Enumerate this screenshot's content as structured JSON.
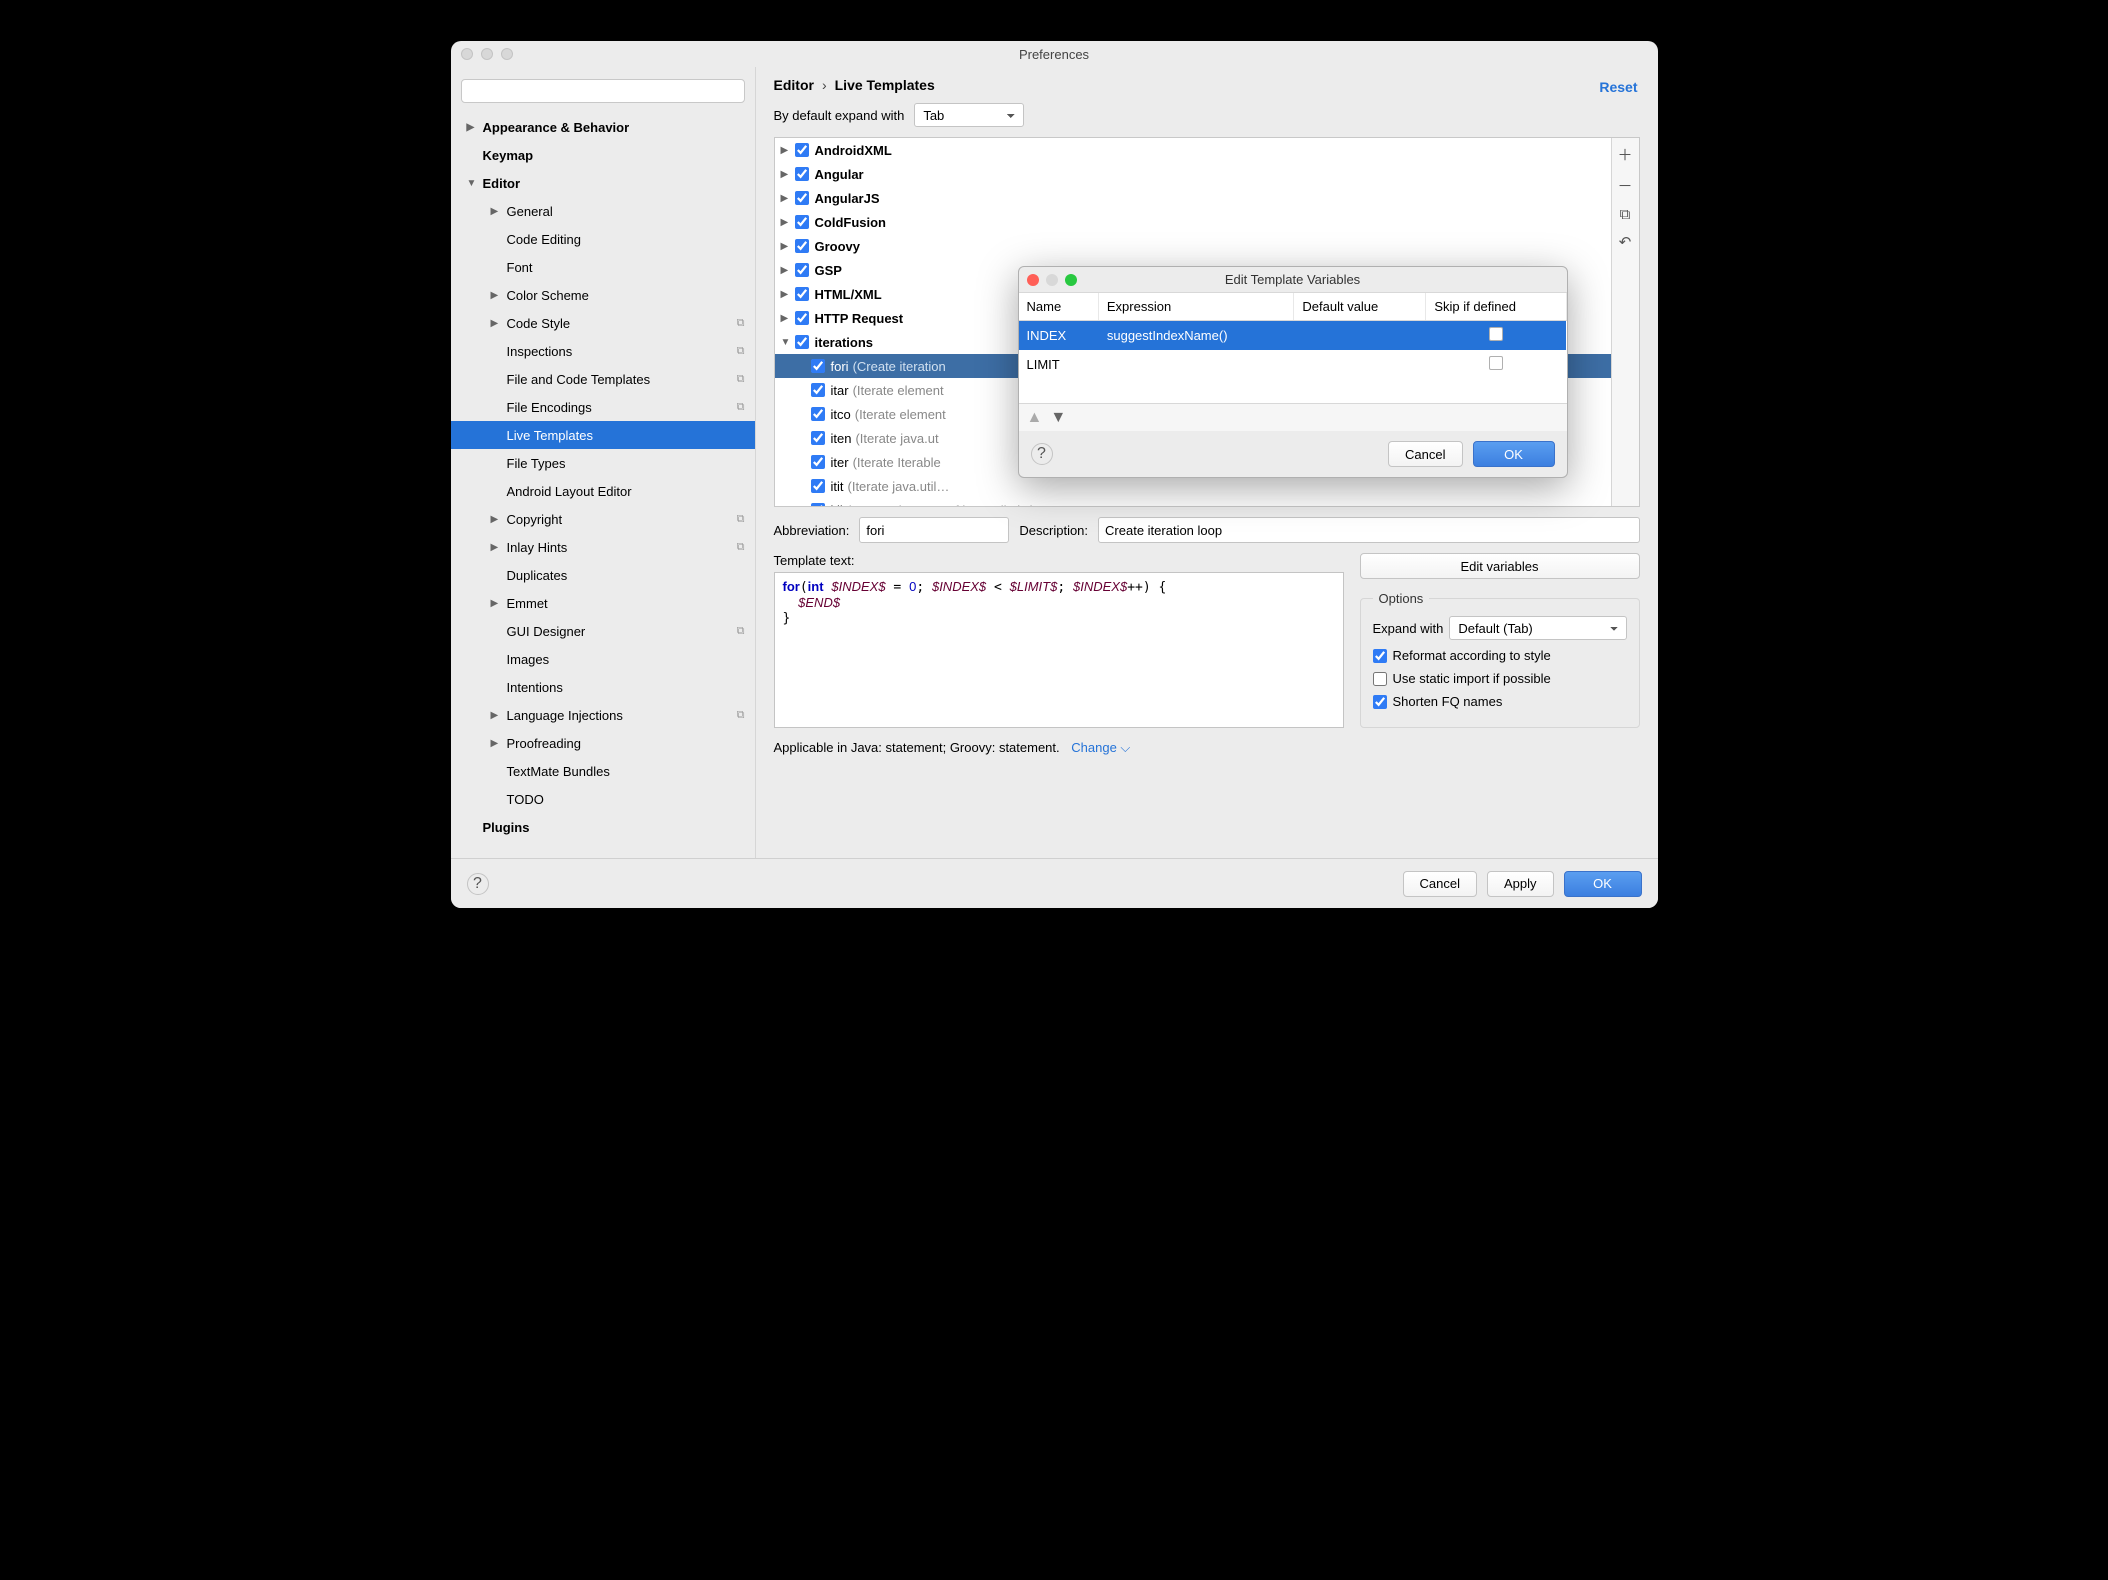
{
  "window": {
    "title": "Preferences"
  },
  "breadcrumb": {
    "section": "Editor",
    "page": "Live Templates",
    "reset": "Reset"
  },
  "sidebar": {
    "search_placeholder": "",
    "items": [
      {
        "label": "Appearance & Behavior",
        "arrow": "▶",
        "bold": true
      },
      {
        "label": "Keymap",
        "bold": true
      },
      {
        "label": "Editor",
        "arrow": "▼",
        "bold": true
      },
      {
        "label": "General",
        "arrow": "▶",
        "indent": 1
      },
      {
        "label": "Code Editing",
        "indent": 1
      },
      {
        "label": "Font",
        "indent": 1
      },
      {
        "label": "Color Scheme",
        "arrow": "▶",
        "indent": 1
      },
      {
        "label": "Code Style",
        "arrow": "▶",
        "indent": 1,
        "copy": true
      },
      {
        "label": "Inspections",
        "indent": 1,
        "copy": true
      },
      {
        "label": "File and Code Templates",
        "indent": 1,
        "copy": true
      },
      {
        "label": "File Encodings",
        "indent": 1,
        "copy": true
      },
      {
        "label": "Live Templates",
        "indent": 1,
        "selected": true
      },
      {
        "label": "File Types",
        "indent": 1
      },
      {
        "label": "Android Layout Editor",
        "indent": 1
      },
      {
        "label": "Copyright",
        "arrow": "▶",
        "indent": 1,
        "copy": true
      },
      {
        "label": "Inlay Hints",
        "arrow": "▶",
        "indent": 1,
        "copy": true
      },
      {
        "label": "Duplicates",
        "indent": 1
      },
      {
        "label": "Emmet",
        "arrow": "▶",
        "indent": 1
      },
      {
        "label": "GUI Designer",
        "indent": 1,
        "copy": true
      },
      {
        "label": "Images",
        "indent": 1
      },
      {
        "label": "Intentions",
        "indent": 1
      },
      {
        "label": "Language Injections",
        "arrow": "▶",
        "indent": 1,
        "copy": true
      },
      {
        "label": "Proofreading",
        "arrow": "▶",
        "indent": 1
      },
      {
        "label": "TextMate Bundles",
        "indent": 1
      },
      {
        "label": "TODO",
        "indent": 1
      },
      {
        "label": "Plugins",
        "bold": true
      }
    ]
  },
  "expand": {
    "label": "By default expand with",
    "value": "Tab"
  },
  "templates": [
    {
      "name": "AndroidXML",
      "checked": true,
      "arrow": "▶"
    },
    {
      "name": "Angular",
      "checked": true,
      "arrow": "▶"
    },
    {
      "name": "AngularJS",
      "checked": true,
      "arrow": "▶"
    },
    {
      "name": "ColdFusion",
      "checked": true,
      "arrow": "▶"
    },
    {
      "name": "Groovy",
      "checked": true,
      "arrow": "▶"
    },
    {
      "name": "GSP",
      "checked": true,
      "arrow": "▶"
    },
    {
      "name": "HTML/XML",
      "checked": true,
      "arrow": "▶"
    },
    {
      "name": "HTTP Request",
      "checked": true,
      "arrow": "▶"
    },
    {
      "name": "iterations",
      "checked": true,
      "arrow": "▼",
      "children": [
        {
          "name": "fori",
          "desc": "(Create iteration",
          "checked": true,
          "selected": true
        },
        {
          "name": "itar",
          "desc": "(Iterate element",
          "checked": true
        },
        {
          "name": "itco",
          "desc": "(Iterate element",
          "checked": true
        },
        {
          "name": "iten",
          "desc": "(Iterate java.ut",
          "checked": true
        },
        {
          "name": "iter",
          "desc": "(Iterate Iterable",
          "checked": true
        },
        {
          "name": "itit",
          "desc": "(Iterate java.util…",
          "checked": true
        },
        {
          "name": "itli",
          "desc": "(Iterate elements of java.util.List)",
          "checked": true
        }
      ]
    }
  ],
  "details": {
    "abbr_label": "Abbreviation:",
    "abbr_value": "fori",
    "desc_label": "Description:",
    "desc_value": "Create iteration loop",
    "template_label": "Template text:",
    "edit_vars": "Edit variables"
  },
  "options": {
    "legend": "Options",
    "expand_label": "Expand with",
    "expand_value": "Default (Tab)",
    "reformat": "Reformat according to style",
    "static_import": "Use static import if possible",
    "shorten": "Shorten FQ names"
  },
  "applicable": {
    "text": "Applicable in Java: statement; Groovy: statement.",
    "change": "Change"
  },
  "footer": {
    "cancel": "Cancel",
    "apply": "Apply",
    "ok": "OK"
  },
  "dialog": {
    "title": "Edit Template Variables",
    "cols": [
      "Name",
      "Expression",
      "Default value",
      "Skip if defined"
    ],
    "rows": [
      {
        "name": "INDEX",
        "expr": "suggestIndexName()",
        "def": "",
        "skip": false,
        "sel": true
      },
      {
        "name": "LIMIT",
        "expr": "",
        "def": "",
        "skip": false
      }
    ],
    "cancel": "Cancel",
    "ok": "OK"
  }
}
